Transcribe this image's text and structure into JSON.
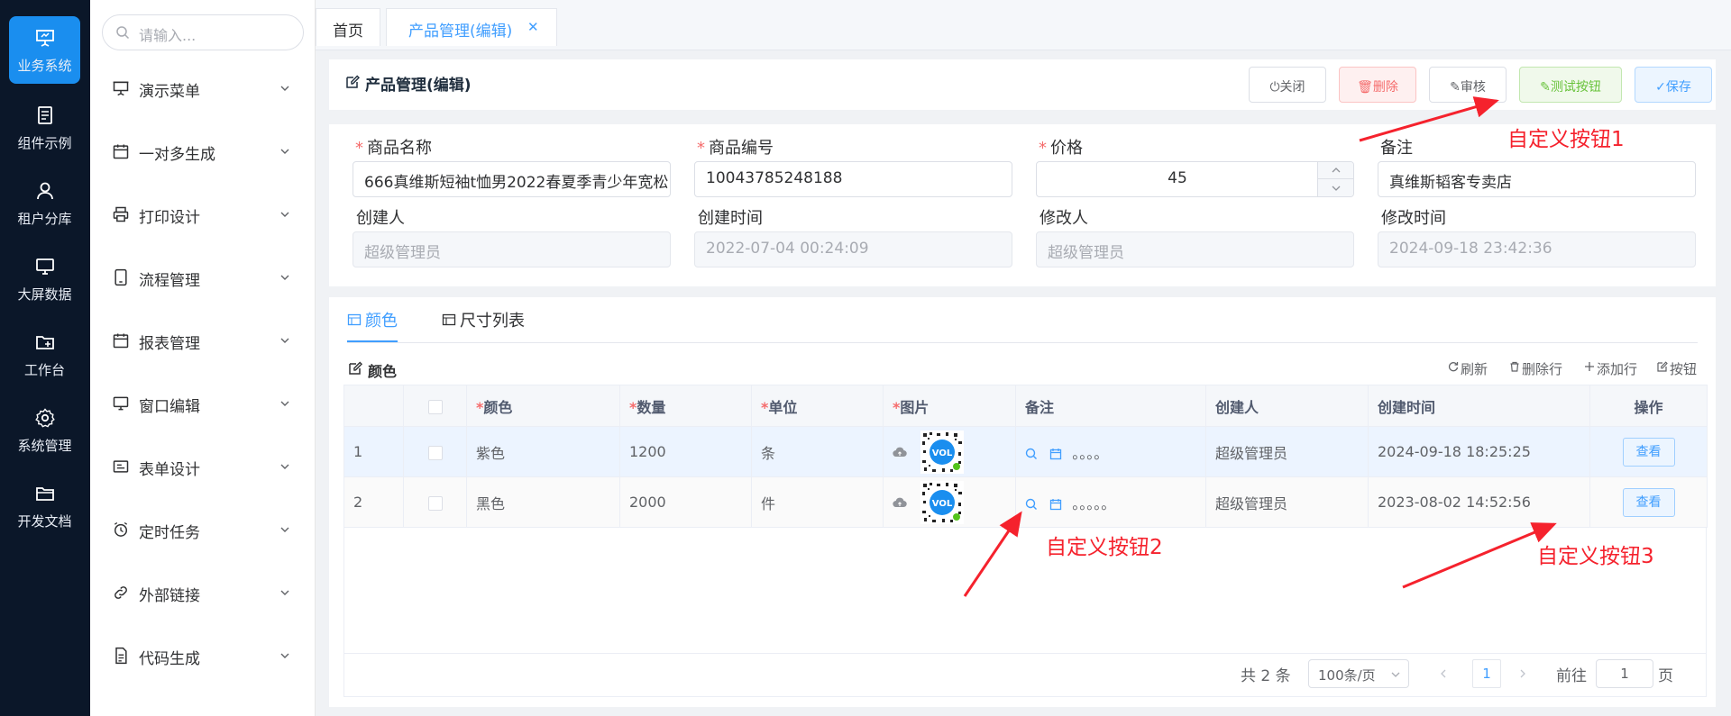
{
  "rail": {
    "items": [
      {
        "label": "业务系统",
        "icon": "presentation-icon",
        "active": true
      },
      {
        "label": "组件示例",
        "icon": "document-list-icon"
      },
      {
        "label": "租户分库",
        "icon": "user-icon"
      },
      {
        "label": "大屏数据",
        "icon": "monitor-icon"
      },
      {
        "label": "工作台",
        "icon": "folder-add-icon"
      },
      {
        "label": "系统管理",
        "icon": "gear-icon"
      },
      {
        "label": "开发文档",
        "icon": "folder-open-icon"
      }
    ]
  },
  "menu": {
    "search_placeholder": "请输入...",
    "items": [
      {
        "label": "演示菜单",
        "icon": "presentation-icon"
      },
      {
        "label": "一对多生成",
        "icon": "calendar-icon"
      },
      {
        "label": "打印设计",
        "icon": "printer-icon"
      },
      {
        "label": "流程管理",
        "icon": "tablet-icon"
      },
      {
        "label": "报表管理",
        "icon": "calendar-icon"
      },
      {
        "label": "窗口编辑",
        "icon": "monitor-icon"
      },
      {
        "label": "表单设计",
        "icon": "form-icon"
      },
      {
        "label": "定时任务",
        "icon": "alarm-clock-icon"
      },
      {
        "label": "外部链接",
        "icon": "link-icon"
      },
      {
        "label": "代码生成",
        "icon": "document-icon"
      }
    ]
  },
  "tabs": {
    "home": "首页",
    "current": "产品管理(编辑)",
    "close_glyph": "✕"
  },
  "header": {
    "title": "产品管理(编辑)",
    "buttons": {
      "close": "关闭",
      "delete": "删除",
      "audit": "审核",
      "test": "测试按钮",
      "save": "保存"
    }
  },
  "form": {
    "name_label": "商品名称",
    "name_value": "666真维斯短袖t恤男2022春夏季青少年宽松",
    "code_label": "商品编号",
    "code_value": "10043785248188",
    "price_label": "价格",
    "price_value": "45",
    "remark_label": "备注",
    "remark_value": "真维斯韬客专卖店",
    "creator_label": "创建人",
    "creator_value": "超级管理员",
    "create_time_label": "创建时间",
    "create_time_value": "2022-07-04 00:24:09",
    "modifier_label": "修改人",
    "modifier_value": "超级管理员",
    "modify_time_label": "修改时间",
    "modify_time_value": "2024-09-18 23:42:36"
  },
  "grid": {
    "tabs": {
      "color": "颜色",
      "size": "尺寸列表"
    },
    "section_title": "颜色",
    "toolbar": {
      "refresh": "刷新",
      "delete_row": "删除行",
      "add_row": "添加行",
      "button": "按钮"
    },
    "columns": {
      "color": "颜色",
      "qty": "数量",
      "unit": "单位",
      "image": "图片",
      "remark": "备注",
      "creator": "创建人",
      "create_time": "创建时间",
      "action": "操作"
    },
    "rows": [
      {
        "no": "1",
        "color": "紫色",
        "qty": "1200",
        "unit": "条",
        "dots": "。。。。",
        "creator": "超级管理员",
        "create_time": "2024-09-18 18:25:25",
        "action": "查看"
      },
      {
        "no": "2",
        "color": "黑色",
        "qty": "2000",
        "unit": "件",
        "dots": "。。。。。",
        "creator": "超级管理员",
        "create_time": "2023-08-02 14:52:56",
        "action": "查看"
      }
    ]
  },
  "pagination": {
    "total": "共 2 条",
    "page_size": "100条/页",
    "current_page": "1",
    "goto_label": "前往",
    "goto_value": "1",
    "page_suffix": "页"
  },
  "annotations": {
    "a1": "自定义按钮1",
    "a2": "自定义按钮2",
    "a3": "自定义按钮3"
  },
  "colors": {
    "rail_bg": "#0b1729",
    "rail_active": "#1a8eef",
    "accent": "#409eff",
    "annotation": "#f5222d"
  }
}
